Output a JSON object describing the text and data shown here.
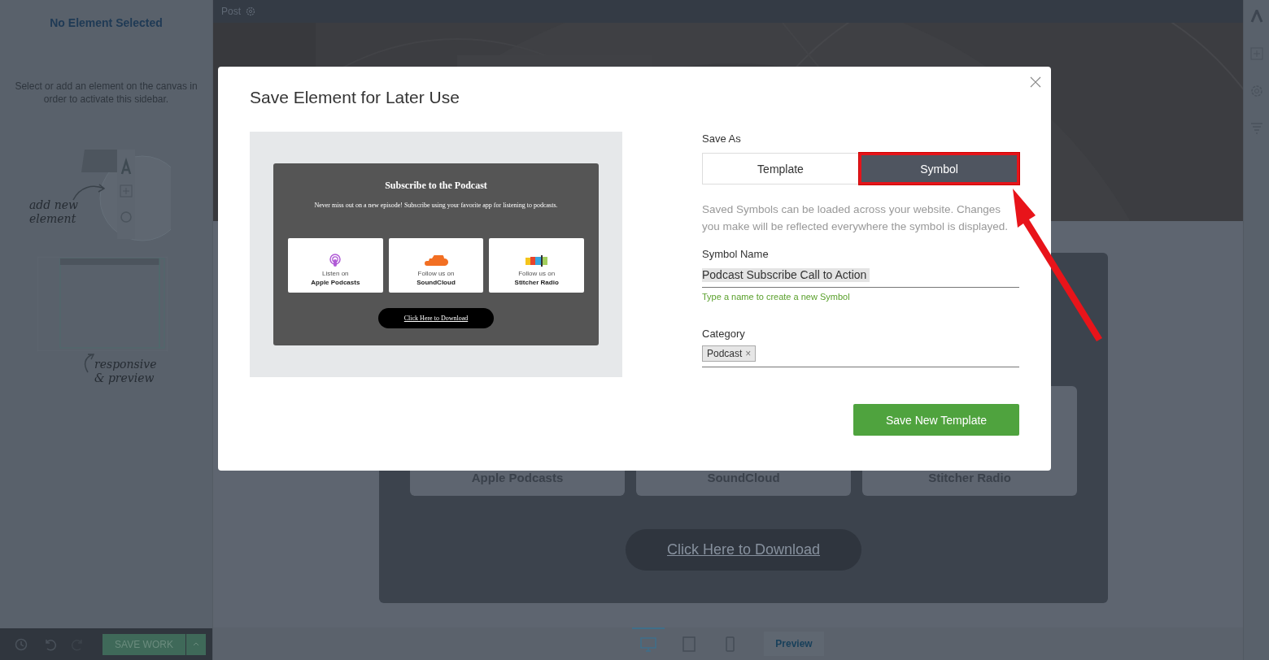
{
  "sidebar": {
    "title": "No Element Selected",
    "hint": "Select or add an element on the canvas in order to activate this sidebar.",
    "add_note": "add new element",
    "preview_note": "responsive & preview",
    "save_button": "SAVE WORK"
  },
  "top_bar": {
    "label": "Post"
  },
  "canvas": {
    "cards": [
      {
        "name": "Apple Podcasts"
      },
      {
        "name": "SoundCloud"
      },
      {
        "name": "Stitcher Radio"
      }
    ],
    "download_button": "Click Here to Download"
  },
  "device_bar": {
    "devices": [
      {
        "kind": "desktop",
        "selected": true
      },
      {
        "kind": "tablet",
        "selected": false
      },
      {
        "kind": "phone",
        "selected": false
      }
    ],
    "preview_button": "Preview"
  },
  "modal": {
    "title": "Save Element for Later Use",
    "preview": {
      "heading": "Subscribe to the Podcast",
      "subtext": "Never miss out on a new episode! Subscribe using your favorite app for listening to podcasts.",
      "apps": [
        {
          "kind": "podcasts",
          "caption": "Listen on",
          "name": "Apple Podcasts"
        },
        {
          "kind": "soundcloud",
          "caption": "Follow us on",
          "name": "SoundCloud"
        },
        {
          "kind": "stitcher",
          "caption": "Follow us on",
          "name": "Stitcher Radio"
        }
      ],
      "button": "Click Here to Download"
    },
    "save_as_label": "Save As",
    "options": [
      {
        "label": "Template",
        "selected": false,
        "highlighted": false
      },
      {
        "label": "Symbol",
        "selected": true,
        "highlighted": true
      }
    ],
    "description": "Saved Symbols can be loaded across your website. Changes you make will be reflected everywhere the symbol is displayed.",
    "name_label": "Symbol Name",
    "name_value": "Podcast Subscribe Call to Action",
    "name_hint": "Type a name to create a new Symbol",
    "category_label": "Category",
    "tags": [
      {
        "label": "Podcast",
        "remove": "×"
      }
    ],
    "submit_button": "Save New Template"
  }
}
